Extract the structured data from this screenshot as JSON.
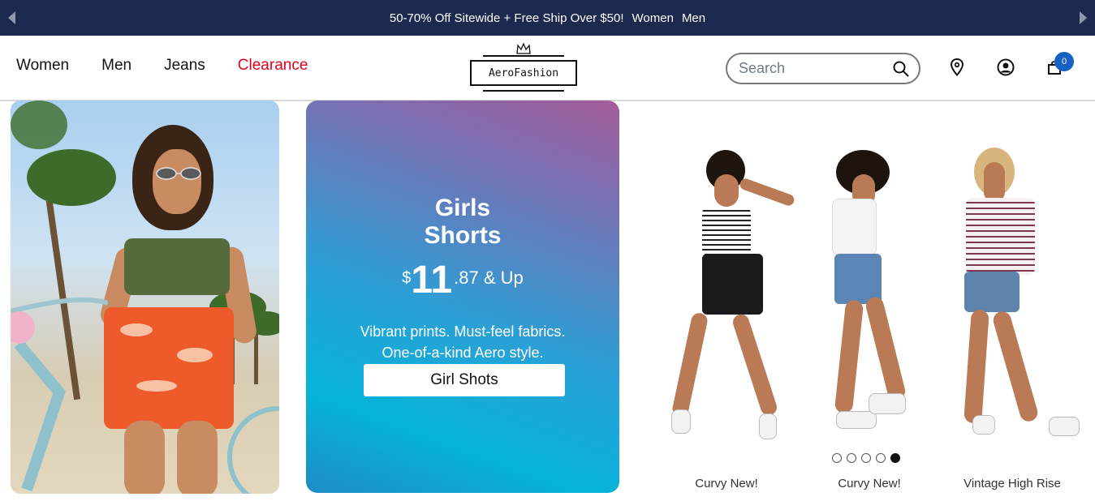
{
  "promo_bar": {
    "text": "50-70% Off Sitewide + Free Ship Over $50!",
    "link_women": "Women",
    "link_men": "Men",
    "prev_icon": "chevron-left-icon",
    "next_icon": "chevron-right-icon"
  },
  "nav": {
    "items": [
      {
        "label": "Women"
      },
      {
        "label": "Men"
      },
      {
        "label": "Jeans"
      },
      {
        "label": "Clearance",
        "color": "#e0001b"
      }
    ]
  },
  "logo": {
    "text": "AeroFashion",
    "icon": "crown-icon"
  },
  "search": {
    "placeholder": "Search",
    "value": "",
    "icon": "search-icon"
  },
  "header_icons": {
    "store_locator": "location-pin-icon",
    "account": "user-icon",
    "cart": "shopping-bag-icon",
    "cart_count": "0"
  },
  "hero_card": {
    "title_line1": "Girls",
    "title_line2": "Shorts",
    "price_currency": "$",
    "price_dollars": "11",
    "price_rest": ".87 & Up",
    "desc_line1": "Vibrant prints. Must-feel fabrics.",
    "desc_line2": "One-of-a-kind Aero style.",
    "cta_label": "Girl Shots"
  },
  "carousel": {
    "captions": [
      "Curvy New!",
      "Curvy New!",
      "Vintage High Rise"
    ],
    "dot_count": 5,
    "active_dot": 5
  },
  "colors": {
    "promo_bg": "#1b2a4e",
    "accent_blue": "#1760c4",
    "clearance_red": "#e0001b"
  }
}
